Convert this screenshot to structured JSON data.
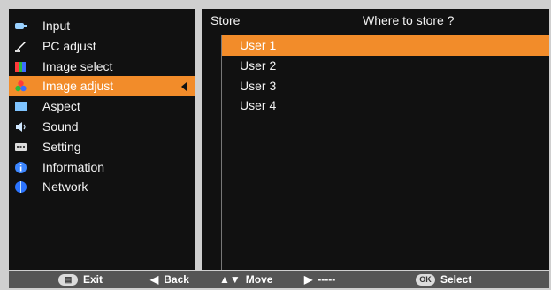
{
  "menu": {
    "items": [
      {
        "label": "Input",
        "icon": "input-icon"
      },
      {
        "label": "PC adjust",
        "icon": "pc-adjust-icon"
      },
      {
        "label": "Image select",
        "icon": "image-select-icon"
      },
      {
        "label": "Image adjust",
        "icon": "image-adjust-icon"
      },
      {
        "label": "Aspect",
        "icon": "aspect-icon"
      },
      {
        "label": "Sound",
        "icon": "sound-icon"
      },
      {
        "label": "Setting",
        "icon": "setting-icon"
      },
      {
        "label": "Information",
        "icon": "information-icon"
      },
      {
        "label": "Network",
        "icon": "network-icon"
      }
    ],
    "selected_index": 3
  },
  "store_panel": {
    "header_left": "Store",
    "header_right": "Where to store ?",
    "items": [
      "User 1",
      "User 2",
      "User 3",
      "User 4"
    ],
    "selected_index": 0
  },
  "footer": {
    "exit_label": "Exit",
    "back_label": "Back",
    "move_label": "Move",
    "right_label": "-----",
    "ok_key": "OK",
    "select_label": "Select"
  },
  "colors": {
    "accent": "#f28c2a",
    "panel_bg": "#111111",
    "frame_bg": "#cfcfcf",
    "footer_bg": "#555555"
  }
}
